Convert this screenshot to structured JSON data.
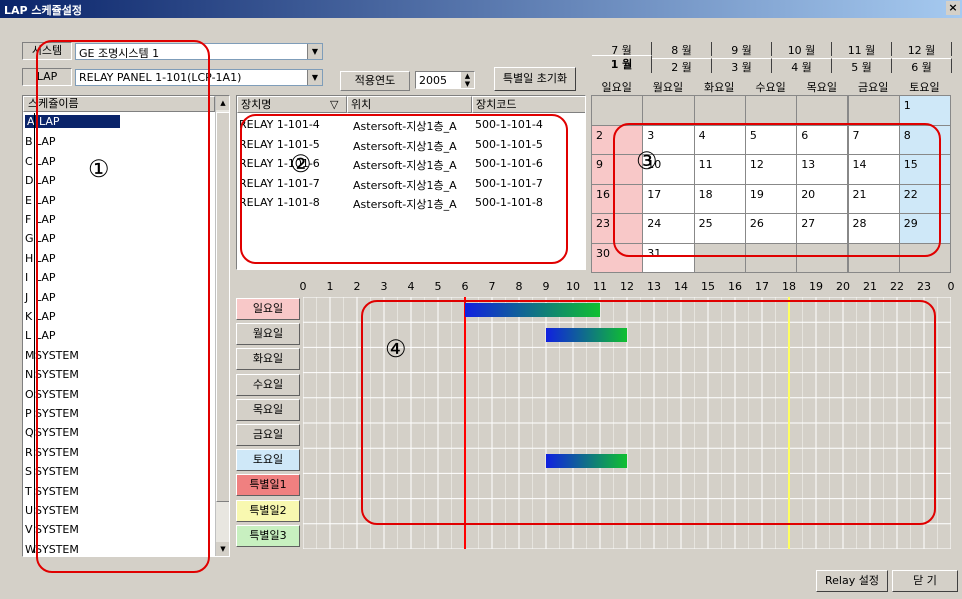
{
  "window": {
    "title": "LAP 스케쥴설정",
    "close": "×"
  },
  "system_label": "시스템",
  "system_value": "GE 조명시스템 1",
  "panel_label": "LAP",
  "panel_value": "RELAY PANEL 1-101(LCP-1A1)",
  "year_label": "적용연도",
  "year_value": "2005",
  "holiday_reset": "특별일 초기화",
  "schedule_list": {
    "header": "스케쥴이름",
    "items": [
      {
        "letter": "A",
        "name": "LAP"
      },
      {
        "letter": "B",
        "name": "LAP"
      },
      {
        "letter": "C",
        "name": "LAP"
      },
      {
        "letter": "D",
        "name": "LAP"
      },
      {
        "letter": "E",
        "name": "LAP"
      },
      {
        "letter": "F",
        "name": "LAP"
      },
      {
        "letter": "G",
        "name": "LAP"
      },
      {
        "letter": "H",
        "name": "LAP"
      },
      {
        "letter": "I",
        "name": "LAP"
      },
      {
        "letter": "J",
        "name": "LAP"
      },
      {
        "letter": "K",
        "name": "LAP"
      },
      {
        "letter": "L",
        "name": "LAP"
      },
      {
        "letter": "M",
        "name": "SYSTEM"
      },
      {
        "letter": "N",
        "name": "SYSTEM"
      },
      {
        "letter": "O",
        "name": "SYSTEM"
      },
      {
        "letter": "P",
        "name": "SYSTEM"
      },
      {
        "letter": "Q",
        "name": "SYSTEM"
      },
      {
        "letter": "R",
        "name": "SYSTEM"
      },
      {
        "letter": "S",
        "name": "SYSTEM"
      },
      {
        "letter": "T",
        "name": "SYSTEM"
      },
      {
        "letter": "U",
        "name": "SYSTEM"
      },
      {
        "letter": "V",
        "name": "SYSTEM"
      },
      {
        "letter": "W",
        "name": "SYSTEM"
      }
    ]
  },
  "device_table": {
    "headers": {
      "name": "장치명",
      "sort": "▽",
      "location": "위치",
      "code": "장치코드"
    },
    "rows": [
      {
        "name": "RELAY 1-101-4",
        "location": "Astersoft-지상1층_A",
        "code": "500-1-101-4"
      },
      {
        "name": "RELAY 1-101-5",
        "location": "Astersoft-지상1층_A",
        "code": "500-1-101-5"
      },
      {
        "name": "RELAY 1-101-6",
        "location": "Astersoft-지상1층_A",
        "code": "500-1-101-6"
      },
      {
        "name": "RELAY 1-101-7",
        "location": "Astersoft-지상1층_A",
        "code": "500-1-101-7"
      },
      {
        "name": "RELAY 1-101-8",
        "location": "Astersoft-지상1층_A",
        "code": "500-1-101-8"
      }
    ]
  },
  "month_tabs_top": [
    "7 월",
    "8 월",
    "9 월",
    "10 월",
    "11 월",
    "12 월"
  ],
  "month_tabs_bottom": [
    "1 월",
    "2 월",
    "3 월",
    "4 월",
    "5 월",
    "6 월"
  ],
  "calendar": {
    "day_headers": [
      "일요일",
      "월요일",
      "화요일",
      "수요일",
      "목요일",
      "금요일",
      "토요일"
    ],
    "weeks": [
      [
        "",
        "",
        "",
        "",
        "",
        "",
        "1"
      ],
      [
        "2",
        "3",
        "4",
        "5",
        "6",
        "7",
        "8"
      ],
      [
        "9",
        "10",
        "11",
        "12",
        "13",
        "14",
        "15"
      ],
      [
        "16",
        "17",
        "18",
        "19",
        "20",
        "21",
        "22"
      ],
      [
        "23",
        "24",
        "25",
        "26",
        "27",
        "28",
        "29"
      ],
      [
        "30",
        "31",
        "",
        "",
        "",
        "",
        ""
      ]
    ]
  },
  "timeline": {
    "hours": [
      "0",
      "1",
      "2",
      "3",
      "4",
      "5",
      "6",
      "7",
      "8",
      "9",
      "10",
      "11",
      "12",
      "13",
      "14",
      "15",
      "16",
      "17",
      "18",
      "19",
      "20",
      "21",
      "22",
      "23",
      "0"
    ],
    "days": [
      {
        "label": "일요일",
        "color": "#f8c8c8"
      },
      {
        "label": "월요일",
        "color": "#d4d0c8"
      },
      {
        "label": "화요일",
        "color": "#d4d0c8"
      },
      {
        "label": "수요일",
        "color": "#d4d0c8"
      },
      {
        "label": "목요일",
        "color": "#d4d0c8"
      },
      {
        "label": "금요일",
        "color": "#d4d0c8"
      },
      {
        "label": "토요일",
        "color": "#cfe8f8"
      },
      {
        "label": "특별일1",
        "color": "#f08080"
      },
      {
        "label": "특별일2",
        "color": "#f8f8b0"
      },
      {
        "label": "특별일3",
        "color": "#c8f0c0"
      }
    ],
    "bars": [
      {
        "day": 0,
        "start_hour": 6.0,
        "end_hour": 11.0
      },
      {
        "day": 1,
        "start_hour": 9.0,
        "end_hour": 12.0
      },
      {
        "day": 6,
        "start_hour": 9.0,
        "end_hour": 12.0
      }
    ],
    "current_hour": 6.0,
    "marker_hour": 18.0
  },
  "markers": [
    "①",
    "②",
    "③",
    "④"
  ],
  "buttons": {
    "relay": "Relay 설정",
    "close": "닫 기"
  },
  "colors": {
    "annotation": "#e00000",
    "selected": "#0a246a"
  }
}
